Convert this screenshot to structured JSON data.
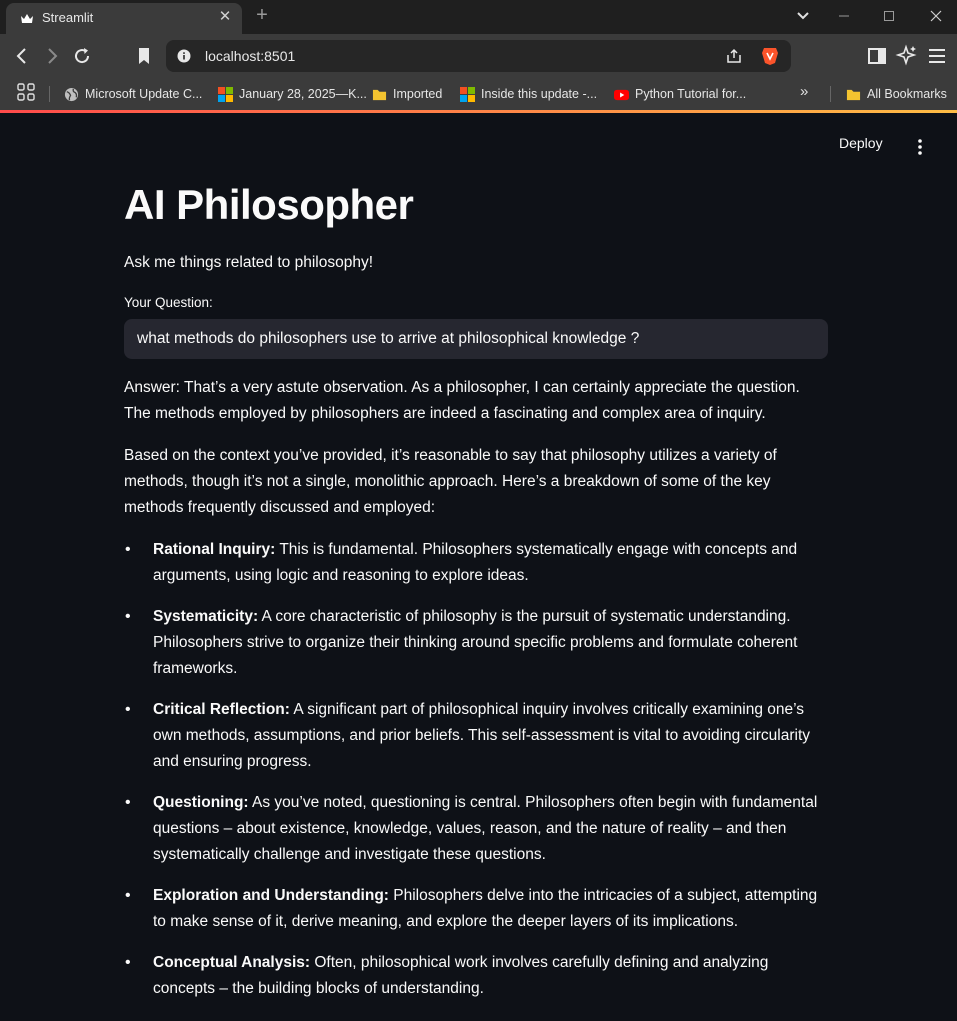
{
  "browser": {
    "tab_title": "Streamlit",
    "url": "localhost:8501",
    "bookmarks": [
      {
        "label": "Microsoft Update C...",
        "icon": "globe-icon"
      },
      {
        "label": "January 28, 2025—K...",
        "icon": "microsoft-logo-icon"
      },
      {
        "label": "Imported",
        "icon": "folder-icon"
      },
      {
        "label": "Inside this update -...",
        "icon": "microsoft-logo-icon"
      },
      {
        "label": "Python Tutorial for...",
        "icon": "youtube-icon"
      }
    ],
    "all_bookmarks": "All Bookmarks"
  },
  "app": {
    "deploy_label": "Deploy",
    "title": "AI Philosopher",
    "subtitle": "Ask me things related to philosophy!",
    "question_label": "Your Question:",
    "question_value": "what methods do philosophers use to arrive at philosophical knowledge ?",
    "answer_intro": "Answer: That’s a very astute observation. As a philosopher, I can certainly appreciate the question. The methods employed by philosophers are indeed a fascinating and complex area of inquiry.",
    "answer_context": "Based on the context you’ve provided, it’s reasonable to say that philosophy utilizes a variety of methods, though it’s not a single, monolithic approach. Here’s a breakdown of some of the key methods frequently discussed and employed:",
    "methods": [
      {
        "term": "Rational Inquiry:",
        "text": " This is fundamental. Philosophers systematically engage with concepts and arguments, using logic and reasoning to explore ideas."
      },
      {
        "term": "Systematicity:",
        "text": " A core characteristic of philosophy is the pursuit of systematic understanding. Philosophers strive to organize their thinking around specific problems and formulate coherent frameworks."
      },
      {
        "term": "Critical Reflection:",
        "text": " A significant part of philosophical inquiry involves critically examining one’s own methods, assumptions, and prior beliefs. This self-assessment is vital to avoiding circularity and ensuring progress."
      },
      {
        "term": "Questioning:",
        "text": " As you’ve noted, questioning is central. Philosophers often begin with fundamental questions – about existence, knowledge, values, reason, and the nature of reality – and then systematically challenge and investigate these questions."
      },
      {
        "term": "Exploration and Understanding:",
        "text": " Philosophers delve into the intricacies of a subject, attempting to make sense of it, derive meaning, and explore the deeper layers of its implications."
      },
      {
        "term": "Conceptual Analysis:",
        "text": " Often, philosophical work involves carefully defining and analyzing concepts – the building blocks of understanding."
      }
    ]
  },
  "colors": {
    "app_background": "#0e1117",
    "input_background": "#262730",
    "text": "#fafafa",
    "chrome_toolbar": "#3b3b3b",
    "accent_start": "#ff4b4b",
    "accent_end": "#ffbd45"
  }
}
